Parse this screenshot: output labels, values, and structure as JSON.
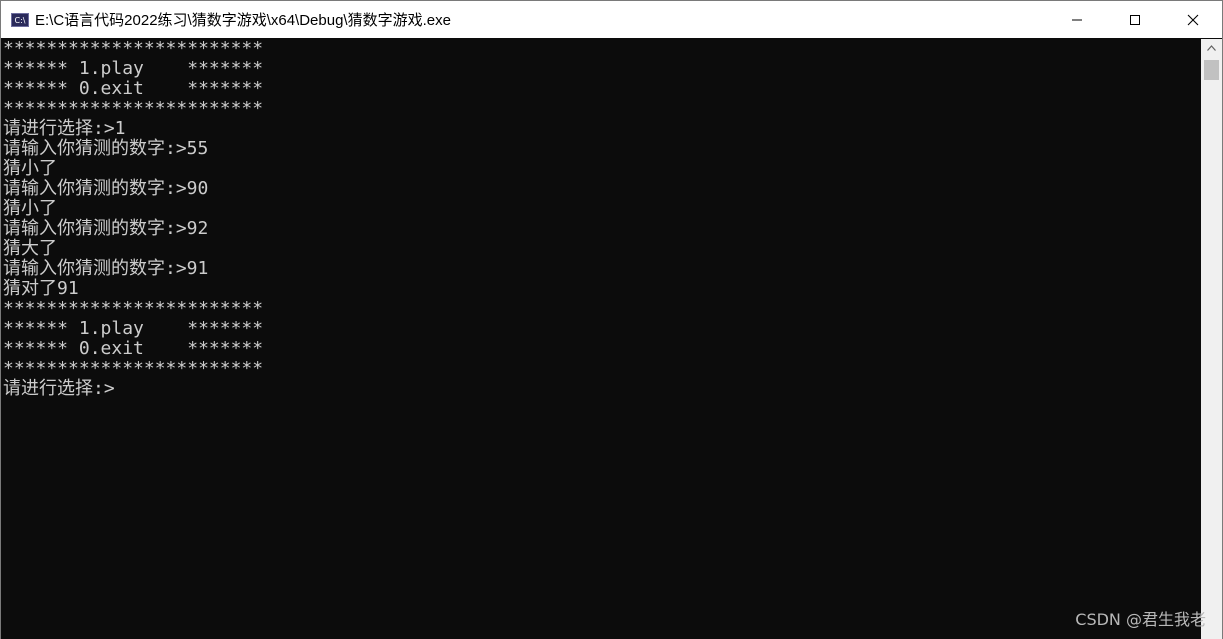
{
  "window": {
    "title": "E:\\C语言代码2022练习\\猜数字游戏\\x64\\Debug\\猜数字游戏.exe",
    "icon_label": "C:\\",
    "icon": "console-app-icon"
  },
  "controls": {
    "minimize": "minimize-icon",
    "maximize": "maximize-icon",
    "close": "close-icon"
  },
  "console": {
    "lines": [
      "************************",
      "****** 1.play    *******",
      "****** 0.exit    *******",
      "************************",
      "请进行选择:>1",
      "请输入你猜测的数字:>55",
      "猜小了",
      "请输入你猜测的数字:>90",
      "猜小了",
      "请输入你猜测的数字:>92",
      "猜大了",
      "请输入你猜测的数字:>91",
      "猜对了91",
      "************************",
      "****** 1.play    *******",
      "****** 0.exit    *******",
      "************************",
      "请进行选择:>"
    ]
  },
  "watermark": "CSDN @君生我老",
  "colors": {
    "console_bg": "#0c0c0c",
    "console_text": "#cccccc",
    "titlebar_bg": "#ffffff"
  }
}
